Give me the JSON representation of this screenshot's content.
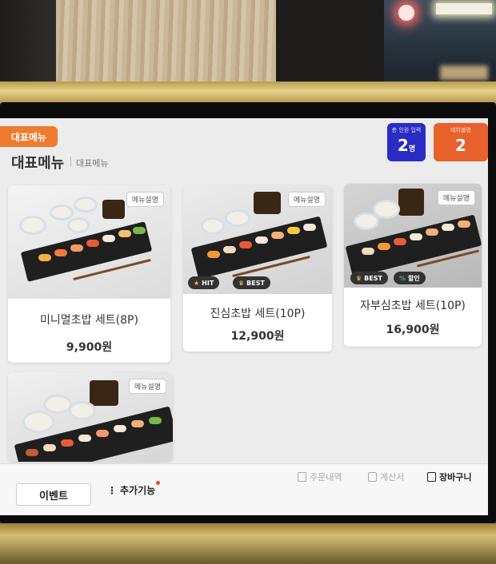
{
  "header": {
    "category_tag": "대표메뉴",
    "page_title": "대표메뉴",
    "breadcrumb": "대표메뉴",
    "people_badge": {
      "label": "총 인원 입력",
      "count": "2",
      "unit": "명"
    },
    "table_badge": {
      "label": "테이블명",
      "value": "2"
    }
  },
  "menu": {
    "items": [
      {
        "name": "미니멀초밥 세트(8P)",
        "price": "9,900원",
        "desc_label": "메뉴설명",
        "tags": []
      },
      {
        "name": "진심초밥 세트(10P)",
        "price": "12,900원",
        "desc_label": "메뉴설명",
        "tags": [
          "HIT",
          "BEST"
        ]
      },
      {
        "name": "자부심초밥 세트(10P)",
        "price": "16,900원",
        "desc_label": "메뉴설명",
        "tags": [
          "BEST",
          "할인"
        ]
      },
      {
        "name": "",
        "price": "",
        "desc_label": "메뉴설명",
        "tags": []
      }
    ]
  },
  "bottom": {
    "event_label": "이벤트",
    "more_label": "추가기능",
    "order_history_label": "주문내역",
    "checkout_label": "계산서",
    "cart_label": "장바구니"
  },
  "colors": {
    "accent_orange": "#f07a2f",
    "people_badge_blue": "#2b2bc6",
    "table_badge_orange": "#e8602a"
  },
  "icons": {
    "star": "star-icon",
    "crown": "crown-icon",
    "discount": "discount-icon",
    "order_history": "receipt-icon",
    "checkout": "bill-icon",
    "cart": "cart-icon",
    "more": "more-vertical-icon"
  }
}
